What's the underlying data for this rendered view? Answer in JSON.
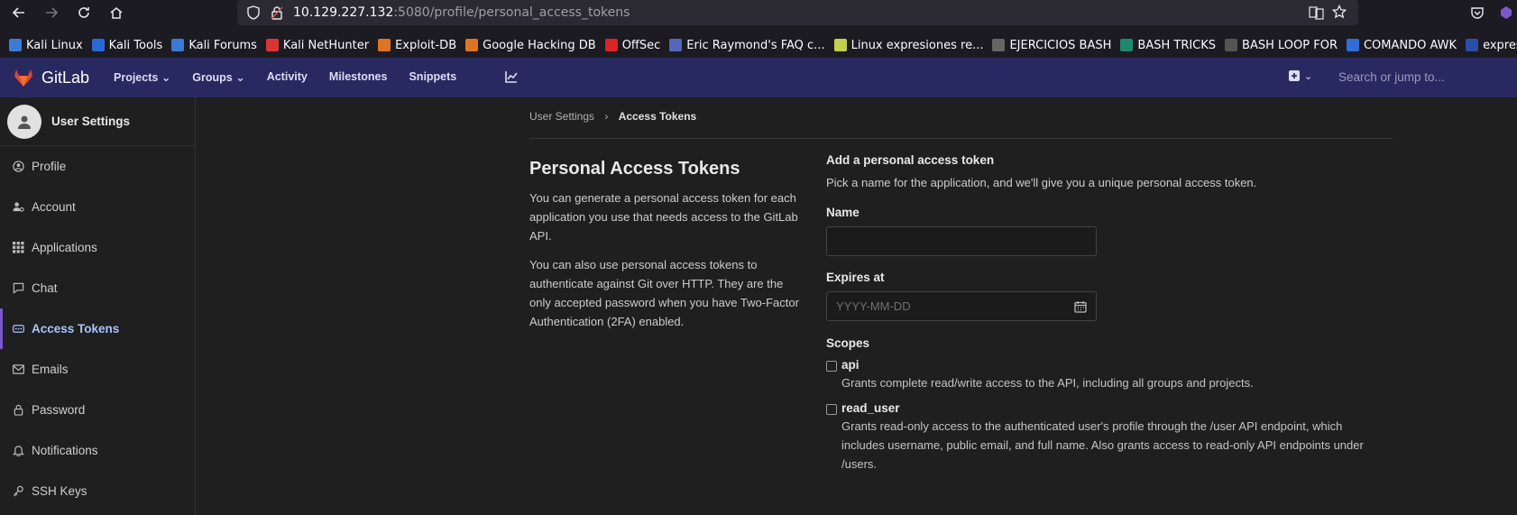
{
  "browser": {
    "url_host": "10.129.227.132",
    "url_rest": ":5080/profile/personal_access_tokens"
  },
  "bookmarks": [
    {
      "label": "Kali Linux",
      "color": "#3b7bd5"
    },
    {
      "label": "Kali Tools",
      "color": "#2a6ad8"
    },
    {
      "label": "Kali Forums",
      "color": "#3b7bd5"
    },
    {
      "label": "Kali NetHunter",
      "color": "#d33"
    },
    {
      "label": "Exploit-DB",
      "color": "#e2731f"
    },
    {
      "label": "Google Hacking DB",
      "color": "#e2731f"
    },
    {
      "label": "OffSec",
      "color": "#d22"
    },
    {
      "label": "Eric Raymond's FAQ c...",
      "color": "#5566bb"
    },
    {
      "label": "Linux expresiones re...",
      "color": "#c2d04a"
    },
    {
      "label": "EJERCICIOS BASH",
      "color": "#666"
    },
    {
      "label": "BASH TRICKS",
      "color": "#1d8a6d"
    },
    {
      "label": "BASH LOOP FOR",
      "color": "#555"
    },
    {
      "label": "COMANDO AWK",
      "color": "#2d6ed8"
    },
    {
      "label": "expres",
      "color": "#2a4fa8"
    }
  ],
  "gitlab": {
    "brand": "GitLab",
    "menu": [
      "Projects",
      "Groups",
      "Activity",
      "Milestones",
      "Snippets"
    ],
    "search_placeholder": "Search or jump to..."
  },
  "sidebar": {
    "title": "User Settings",
    "items": [
      {
        "label": "Profile",
        "icon": "profile-icon",
        "active": false
      },
      {
        "label": "Account",
        "icon": "account-icon",
        "active": false
      },
      {
        "label": "Applications",
        "icon": "applications-icon",
        "active": false
      },
      {
        "label": "Chat",
        "icon": "chat-icon",
        "active": false
      },
      {
        "label": "Access Tokens",
        "icon": "token-icon",
        "active": true
      },
      {
        "label": "Emails",
        "icon": "email-icon",
        "active": false
      },
      {
        "label": "Password",
        "icon": "lock-icon",
        "active": false
      },
      {
        "label": "Notifications",
        "icon": "bell-icon",
        "active": false
      },
      {
        "label": "SSH Keys",
        "icon": "key-icon",
        "active": false
      }
    ]
  },
  "breadcrumb": {
    "parent": "User Settings",
    "current": "Access Tokens"
  },
  "left": {
    "title": "Personal Access Tokens",
    "p1": "You can generate a personal access token for each application you use that needs access to the GitLab API.",
    "p2": "You can also use personal access tokens to authenticate against Git over HTTP. They are the only accepted password when you have Two-Factor Authentication (2FA) enabled."
  },
  "form": {
    "heading": "Add a personal access token",
    "intro": "Pick a name for the application, and we'll give you a unique personal access token.",
    "name_label": "Name",
    "name_value": "",
    "expires_label": "Expires at",
    "expires_placeholder": "YYYY-MM-DD",
    "scopes_label": "Scopes",
    "scopes": [
      {
        "name": "api",
        "desc": "Grants complete read/write access to the API, including all groups and projects."
      },
      {
        "name": "read_user",
        "desc": "Grants read-only access to the authenticated user's profile through the /user API endpoint, which includes username, public email, and full name. Also grants access to read-only API endpoints under /users."
      }
    ]
  }
}
